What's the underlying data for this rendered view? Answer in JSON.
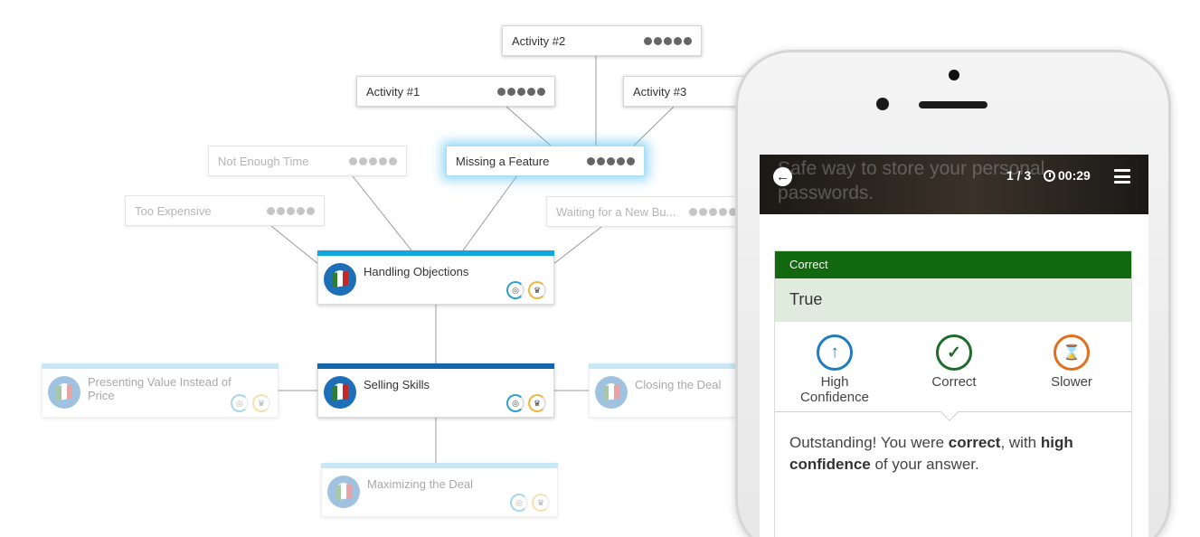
{
  "activities": [
    {
      "label": "Activity #2",
      "faded": false
    },
    {
      "label": "Activity #1",
      "faded": false
    },
    {
      "label": "Activity #3",
      "faded": false
    },
    {
      "label": "Missing a Feature",
      "faded": false,
      "selected": true
    },
    {
      "label": "Not Enough Time",
      "faded": true
    },
    {
      "label": "Too Expensive",
      "faded": true
    },
    {
      "label": "Waiting for a New Bu...",
      "faded": true
    }
  ],
  "skills": [
    {
      "title": "Handling Objections",
      "accent": "#11a7de",
      "faded": false
    },
    {
      "title": "Selling Skills",
      "accent": "#1565ad",
      "faded": false
    },
    {
      "title": "Presenting Value Instead of Price",
      "accent": "#a8dcf1",
      "faded": true
    },
    {
      "title": "Closing the Deal",
      "accent": "#a8dcf1",
      "faded": true
    },
    {
      "title": "Maximizing the Deal",
      "accent": "#a8dcf1",
      "faded": true
    }
  ],
  "quiz": {
    "question": "Safe way to store your personal passwords.",
    "progress": "1 / 3",
    "timer": "00:29",
    "status": "Correct",
    "answer": "True",
    "metrics": [
      {
        "label": "High Confidence",
        "icon": "arrow-up-icon",
        "color": "#1f7dbd"
      },
      {
        "label": "Correct",
        "icon": "check-icon",
        "color": "#1e6b2a"
      },
      {
        "label": "Slower",
        "icon": "hourglass-icon",
        "color": "#e07020"
      }
    ],
    "feedback_intro": "Outstanding! You were ",
    "feedback_strong1": "correct",
    "feedback_mid": ", with ",
    "feedback_strong2": "high confidence",
    "feedback_end": " of your answer."
  },
  "colors": {
    "correct_green": "#12680f",
    "accent_blue": "#11a7de"
  }
}
